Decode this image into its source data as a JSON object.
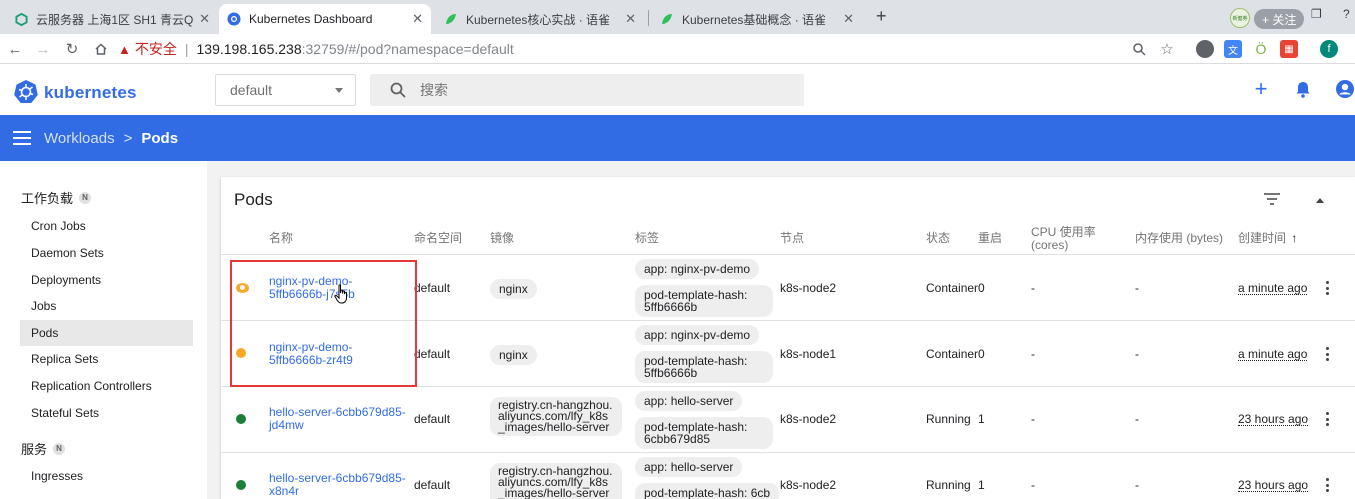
{
  "browser": {
    "tabs": [
      {
        "title": "云服务器 上海1区 SH1 青云Qing"
      },
      {
        "title": "Kubernetes Dashboard"
      },
      {
        "title": "Kubernetes核心实战 · 语雀"
      },
      {
        "title": "Kubernetes基础概念 · 语雀"
      }
    ],
    "follow_label": "+ 关注",
    "ext_profile_text": "新健券",
    "security_label": "不安全",
    "url_host": "139.198.165.238",
    "url_path": ":32759/#/pod?namespace=default",
    "profile_letter": "f"
  },
  "app": {
    "logo_text": "kubernetes",
    "namespace": "default",
    "search_placeholder": "搜索",
    "brand_color": "#326ce5"
  },
  "breadcrumb": {
    "parent": "Workloads",
    "separator": ">",
    "current": "Pods"
  },
  "sidebar": {
    "workloads_label": "工作负载",
    "workloads_badge": "N",
    "items": [
      {
        "label": "Cron Jobs"
      },
      {
        "label": "Daemon Sets"
      },
      {
        "label": "Deployments"
      },
      {
        "label": "Jobs"
      },
      {
        "label": "Pods"
      },
      {
        "label": "Replica Sets"
      },
      {
        "label": "Replication Controllers"
      },
      {
        "label": "Stateful Sets"
      }
    ],
    "services_label": "服务",
    "services_badge": "N",
    "services_items": [
      {
        "label": "Ingresses"
      }
    ]
  },
  "card": {
    "title": "Pods",
    "headers": {
      "name": "名称",
      "namespace": "命名空间",
      "image": "镜像",
      "labels": "标签",
      "node": "节点",
      "status": "状态",
      "restarts": "重启",
      "cpu": "CPU 使用率 (cores)",
      "memory": "内存使用 (bytes)",
      "created": "创建时间",
      "sort_arrow": "↑"
    },
    "rows": [
      {
        "name": "nginx-pv-demo-5ffb6666b-j7s5b",
        "namespace": "default",
        "image": "nginx",
        "label_app": "app: nginx-pv-demo",
        "label_hash": "pod-template-hash: 5ffb6666b",
        "node": "k8s-node2",
        "status": "Container",
        "restarts": "0",
        "cpu": "-",
        "memory": "-",
        "created": "a minute ago",
        "status_color": "#f9a825"
      },
      {
        "name": "nginx-pv-demo-5ffb6666b-zr4t9",
        "namespace": "default",
        "image": "nginx",
        "label_app": "app: nginx-pv-demo",
        "label_hash": "pod-template-hash: 5ffb6666b",
        "node": "k8s-node1",
        "status": "Container",
        "restarts": "0",
        "cpu": "-",
        "memory": "-",
        "created": "a minute ago",
        "status_color": "#f9a825"
      },
      {
        "name": "hello-server-6cbb679d85-jd4mw",
        "namespace": "default",
        "image": "registry.cn-hangzhou.aliyuncs.com/lfy_k8s_images/hello-server",
        "label_app": "app: hello-server",
        "label_hash": "pod-template-hash: 6cbb679d85",
        "node": "k8s-node2",
        "status": "Running",
        "restarts": "1",
        "cpu": "-",
        "memory": "-",
        "created": "23 hours ago",
        "status_color": "#1b7f3b"
      },
      {
        "name": "hello-server-6cbb679d85-x8n4r",
        "namespace": "default",
        "image": "registry.cn-hangzhou.aliyuncs.com/lfy_k8s_images/hello-server",
        "label_app": "app: hello-server",
        "label_hash": "pod-template-hash: 6cb",
        "node": "k8s-node2",
        "status": "Running",
        "restarts": "1",
        "cpu": "-",
        "memory": "-",
        "created": "23 hours ago",
        "status_color": "#1b7f3b"
      }
    ]
  }
}
